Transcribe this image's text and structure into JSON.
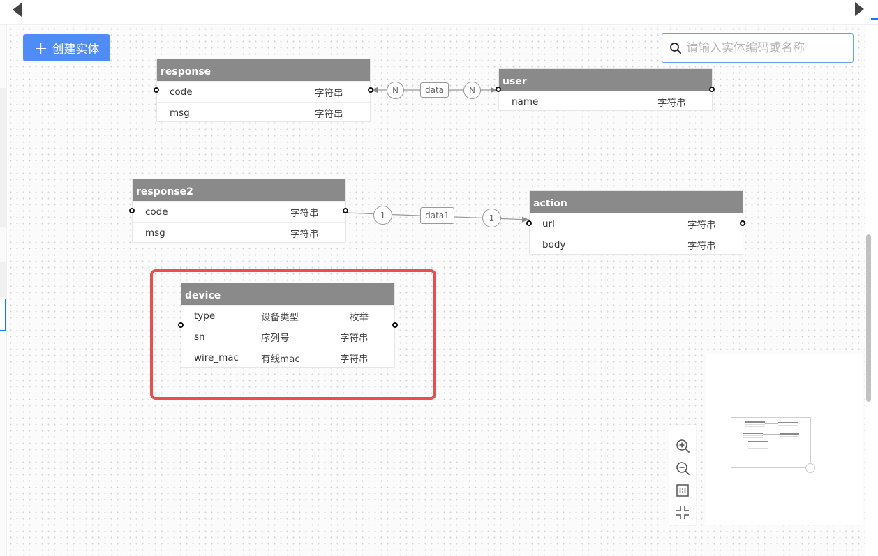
{
  "toolbar": {
    "create_label": "创建实体",
    "search_placeholder": "请输入实体编码或名称"
  },
  "entities": {
    "response": {
      "title": "response",
      "fields": [
        {
          "name": "code",
          "type": "字符串"
        },
        {
          "name": "msg",
          "type": "字符串"
        }
      ]
    },
    "user": {
      "title": "user",
      "fields": [
        {
          "name": "name",
          "type": "字符串"
        }
      ]
    },
    "response2": {
      "title": "response2",
      "fields": [
        {
          "name": "code",
          "type": "字符串"
        },
        {
          "name": "msg",
          "type": "字符串"
        }
      ]
    },
    "action": {
      "title": "action",
      "fields": [
        {
          "name": "url",
          "type": "字符串"
        },
        {
          "name": "body",
          "type": "字符串"
        }
      ]
    },
    "device": {
      "title": "device",
      "fields": [
        {
          "name": "type",
          "desc": "设备类型",
          "type": "枚举"
        },
        {
          "name": "sn",
          "desc": "序列号",
          "type": "字符串"
        },
        {
          "name": "wire_mac",
          "desc": "有线mac",
          "type": "字符串"
        }
      ]
    }
  },
  "relations": [
    {
      "from": "response",
      "to": "user",
      "label": "data",
      "from_card": "N",
      "to_card": "N"
    },
    {
      "from": "response2",
      "to": "action",
      "label": "data1",
      "from_card": "1",
      "to_card": "1"
    }
  ],
  "colors": {
    "primary": "#4f8cf7",
    "entity_header": "#8a8a8a",
    "highlight": "#e8504f"
  },
  "icons": {
    "zoom_in": "zoom-in-icon",
    "zoom_out": "zoom-out-icon",
    "actual_size": "actual-size-icon",
    "fit": "fit-screen-icon",
    "search": "search-icon"
  }
}
